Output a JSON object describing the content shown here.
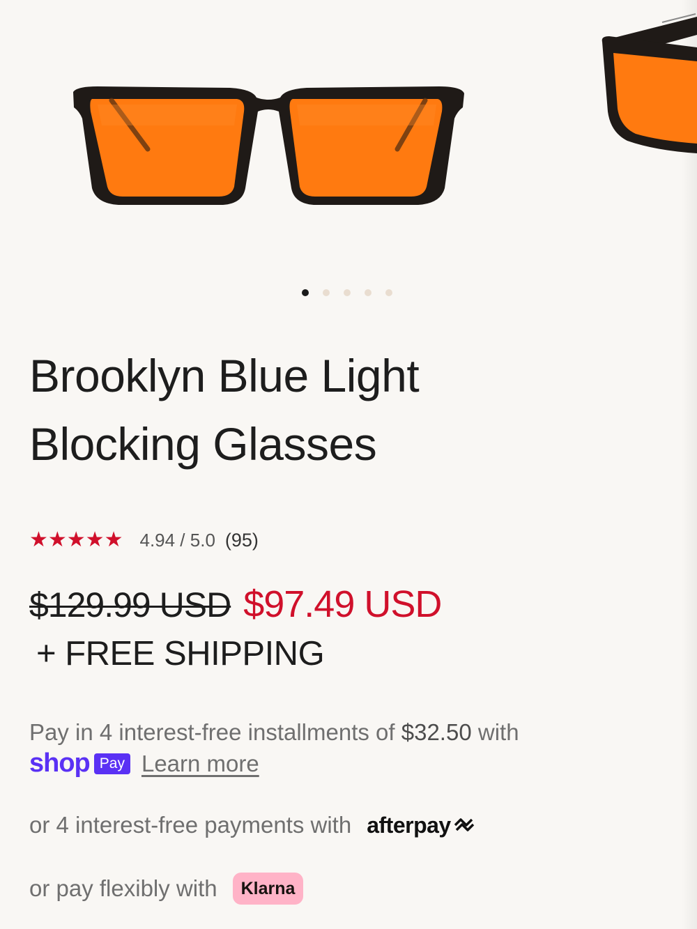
{
  "product": {
    "title_line1": "Brooklyn Blue Light",
    "title_line2": "Blocking Glasses",
    "lens_color": "#ff7a10",
    "frame_color": "#1f1a17"
  },
  "gallery": {
    "image_count": 5,
    "active_index": 0,
    "main_image_icon": "sunglasses-front-view",
    "peek_image_icon": "sunglasses-angled-view"
  },
  "rating": {
    "stars": "★★★★★",
    "score": "4.94 / 5.0",
    "count": "(95)",
    "star_color": "#d0102b"
  },
  "price": {
    "original": "$129.99 USD",
    "sale": "$97.49 USD",
    "shipping": "+ FREE SHIPPING",
    "sale_color": "#d0102b"
  },
  "payments": {
    "shoppay_text": "Pay in 4 interest-free installments of",
    "shoppay_amount": "$32.50",
    "shoppay_with": "with",
    "shop_logo": "shop",
    "pay_badge": "Pay",
    "learn_more": "Learn more",
    "afterpay_text": "or 4 interest-free payments with",
    "afterpay_logo": "afterpay",
    "klarna_text": "or pay flexibly with",
    "klarna_logo": "Klarna",
    "shop_color": "#5a31f4",
    "klarna_color": "#ffb3c7"
  }
}
